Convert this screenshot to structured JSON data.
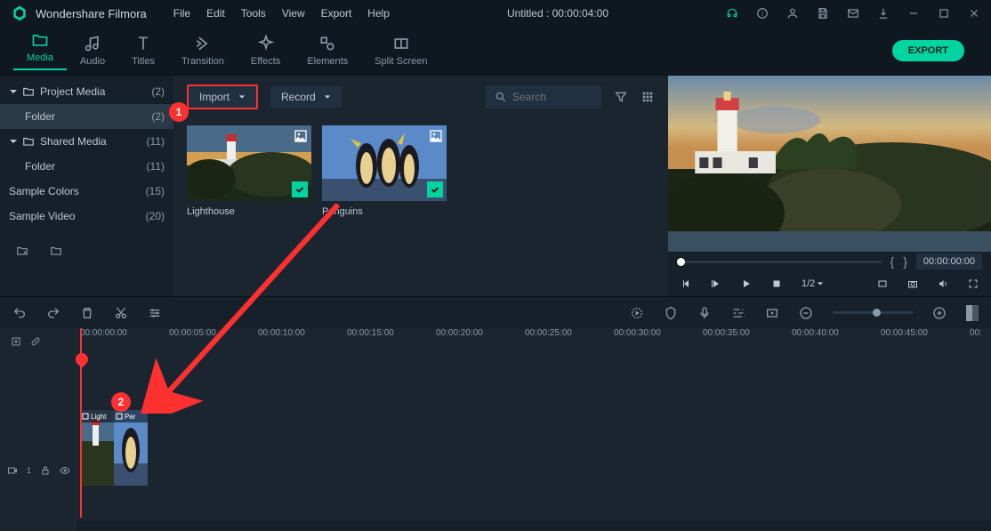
{
  "app": {
    "title": "Wondershare Filmora",
    "project": "Untitled : 00:00:04:00"
  },
  "menu": [
    "File",
    "Edit",
    "Tools",
    "View",
    "Export",
    "Help"
  ],
  "tabs": [
    {
      "label": "Media",
      "active": true,
      "name": "media"
    },
    {
      "label": "Audio",
      "active": false,
      "name": "audio"
    },
    {
      "label": "Titles",
      "active": false,
      "name": "titles"
    },
    {
      "label": "Transition",
      "active": false,
      "name": "transition"
    },
    {
      "label": "Effects",
      "active": false,
      "name": "effects"
    },
    {
      "label": "Elements",
      "active": false,
      "name": "elements"
    },
    {
      "label": "Split Screen",
      "active": false,
      "name": "split-screen"
    }
  ],
  "export_label": "EXPORT",
  "sidebar": {
    "items": [
      {
        "label": "Project Media",
        "count": "(2)",
        "chev": true,
        "folder": true
      },
      {
        "label": "Folder",
        "count": "(2)",
        "indent": true,
        "sel": true
      },
      {
        "label": "Shared Media",
        "count": "(11)",
        "chev": true,
        "folder": true
      },
      {
        "label": "Folder",
        "count": "(11)",
        "indent": true
      },
      {
        "label": "Sample Colors",
        "count": "(15)"
      },
      {
        "label": "Sample Video",
        "count": "(20)"
      }
    ]
  },
  "media_toolbar": {
    "import": "Import",
    "record": "Record",
    "search_placeholder": "Search"
  },
  "clips": [
    {
      "name": "Lighthouse"
    },
    {
      "name": "Penguins"
    }
  ],
  "annotations": {
    "one": "1",
    "two": "2"
  },
  "preview": {
    "time": "00:00:00:00",
    "speed": "1/2"
  },
  "ruler": [
    "00:00:00:00",
    "00:00:05:00",
    "00:00:10:00",
    "00:00:15:00",
    "00:00:20:00",
    "00:00:25:00",
    "00:00:30:00",
    "00:00:35:00",
    "00:00:40:00",
    "00:00:45:00",
    "00:"
  ],
  "timeline_clips": [
    {
      "label": "Light"
    },
    {
      "label": "Per"
    }
  ]
}
